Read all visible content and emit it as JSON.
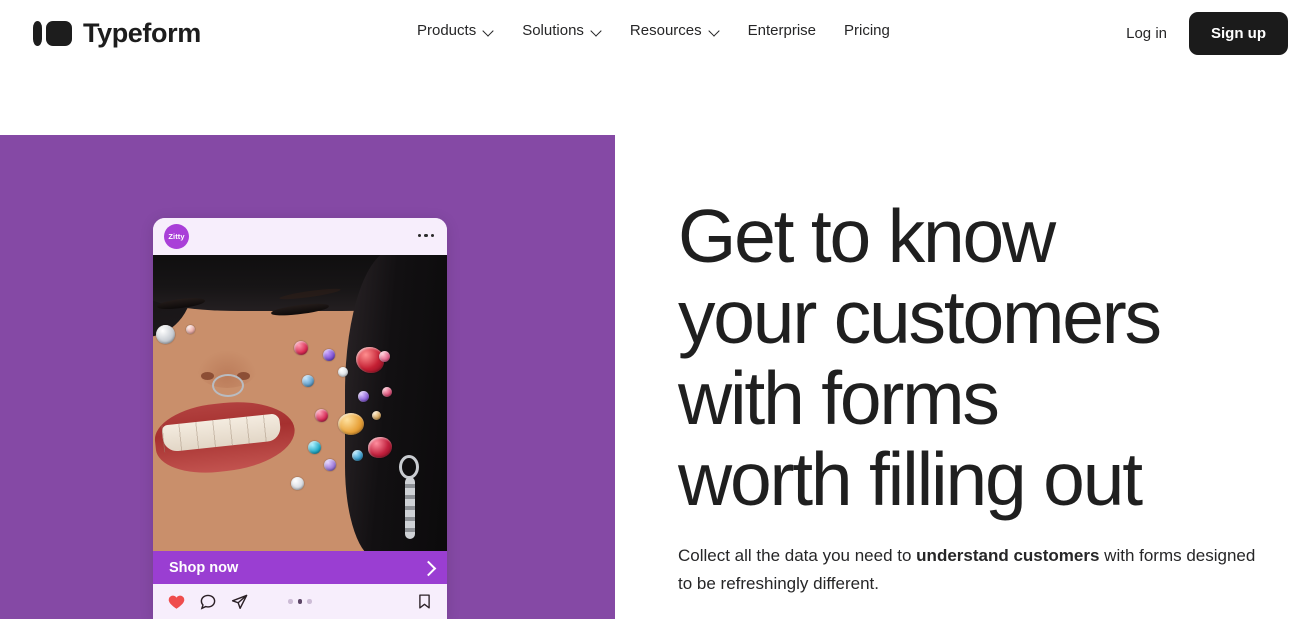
{
  "header": {
    "brand_name": "Typeform",
    "nav_items": [
      {
        "label": "Products",
        "has_chevron": true
      },
      {
        "label": "Solutions",
        "has_chevron": true
      },
      {
        "label": "Resources",
        "has_chevron": true
      },
      {
        "label": "Enterprise",
        "has_chevron": false
      },
      {
        "label": "Pricing",
        "has_chevron": false
      }
    ],
    "login_label": "Log in",
    "signup_label": "Sign up"
  },
  "hero": {
    "title_lines": [
      "Get to know",
      "your customers",
      "with forms",
      "worth filling out"
    ],
    "sub_before": "Collect all the data you need to ",
    "sub_bold": "understand customers",
    "sub_after": " with forms designed to be refreshingly different."
  },
  "post_card": {
    "avatar_label": "Zitty",
    "menu_icon": "more-horizontal-icon",
    "shop_label": "Shop now",
    "shop_chevron_icon": "chevron-right-icon",
    "actions": [
      {
        "name": "like-icon",
        "state": "filled"
      },
      {
        "name": "comment-icon",
        "state": "outline"
      },
      {
        "name": "share-icon",
        "state": "outline"
      },
      {
        "name": "bookmark-icon",
        "state": "outline"
      }
    ],
    "pagination": {
      "total": 3,
      "active_index": 1
    }
  },
  "colors": {
    "panel_purple": "#8549a5",
    "shop_bar_purple": "#9a3ed2",
    "avatar_purple": "#a93fd8",
    "card_light": "#f7eefc",
    "dark": "#1b1b1b",
    "heart_red": "#ef4d4d"
  }
}
